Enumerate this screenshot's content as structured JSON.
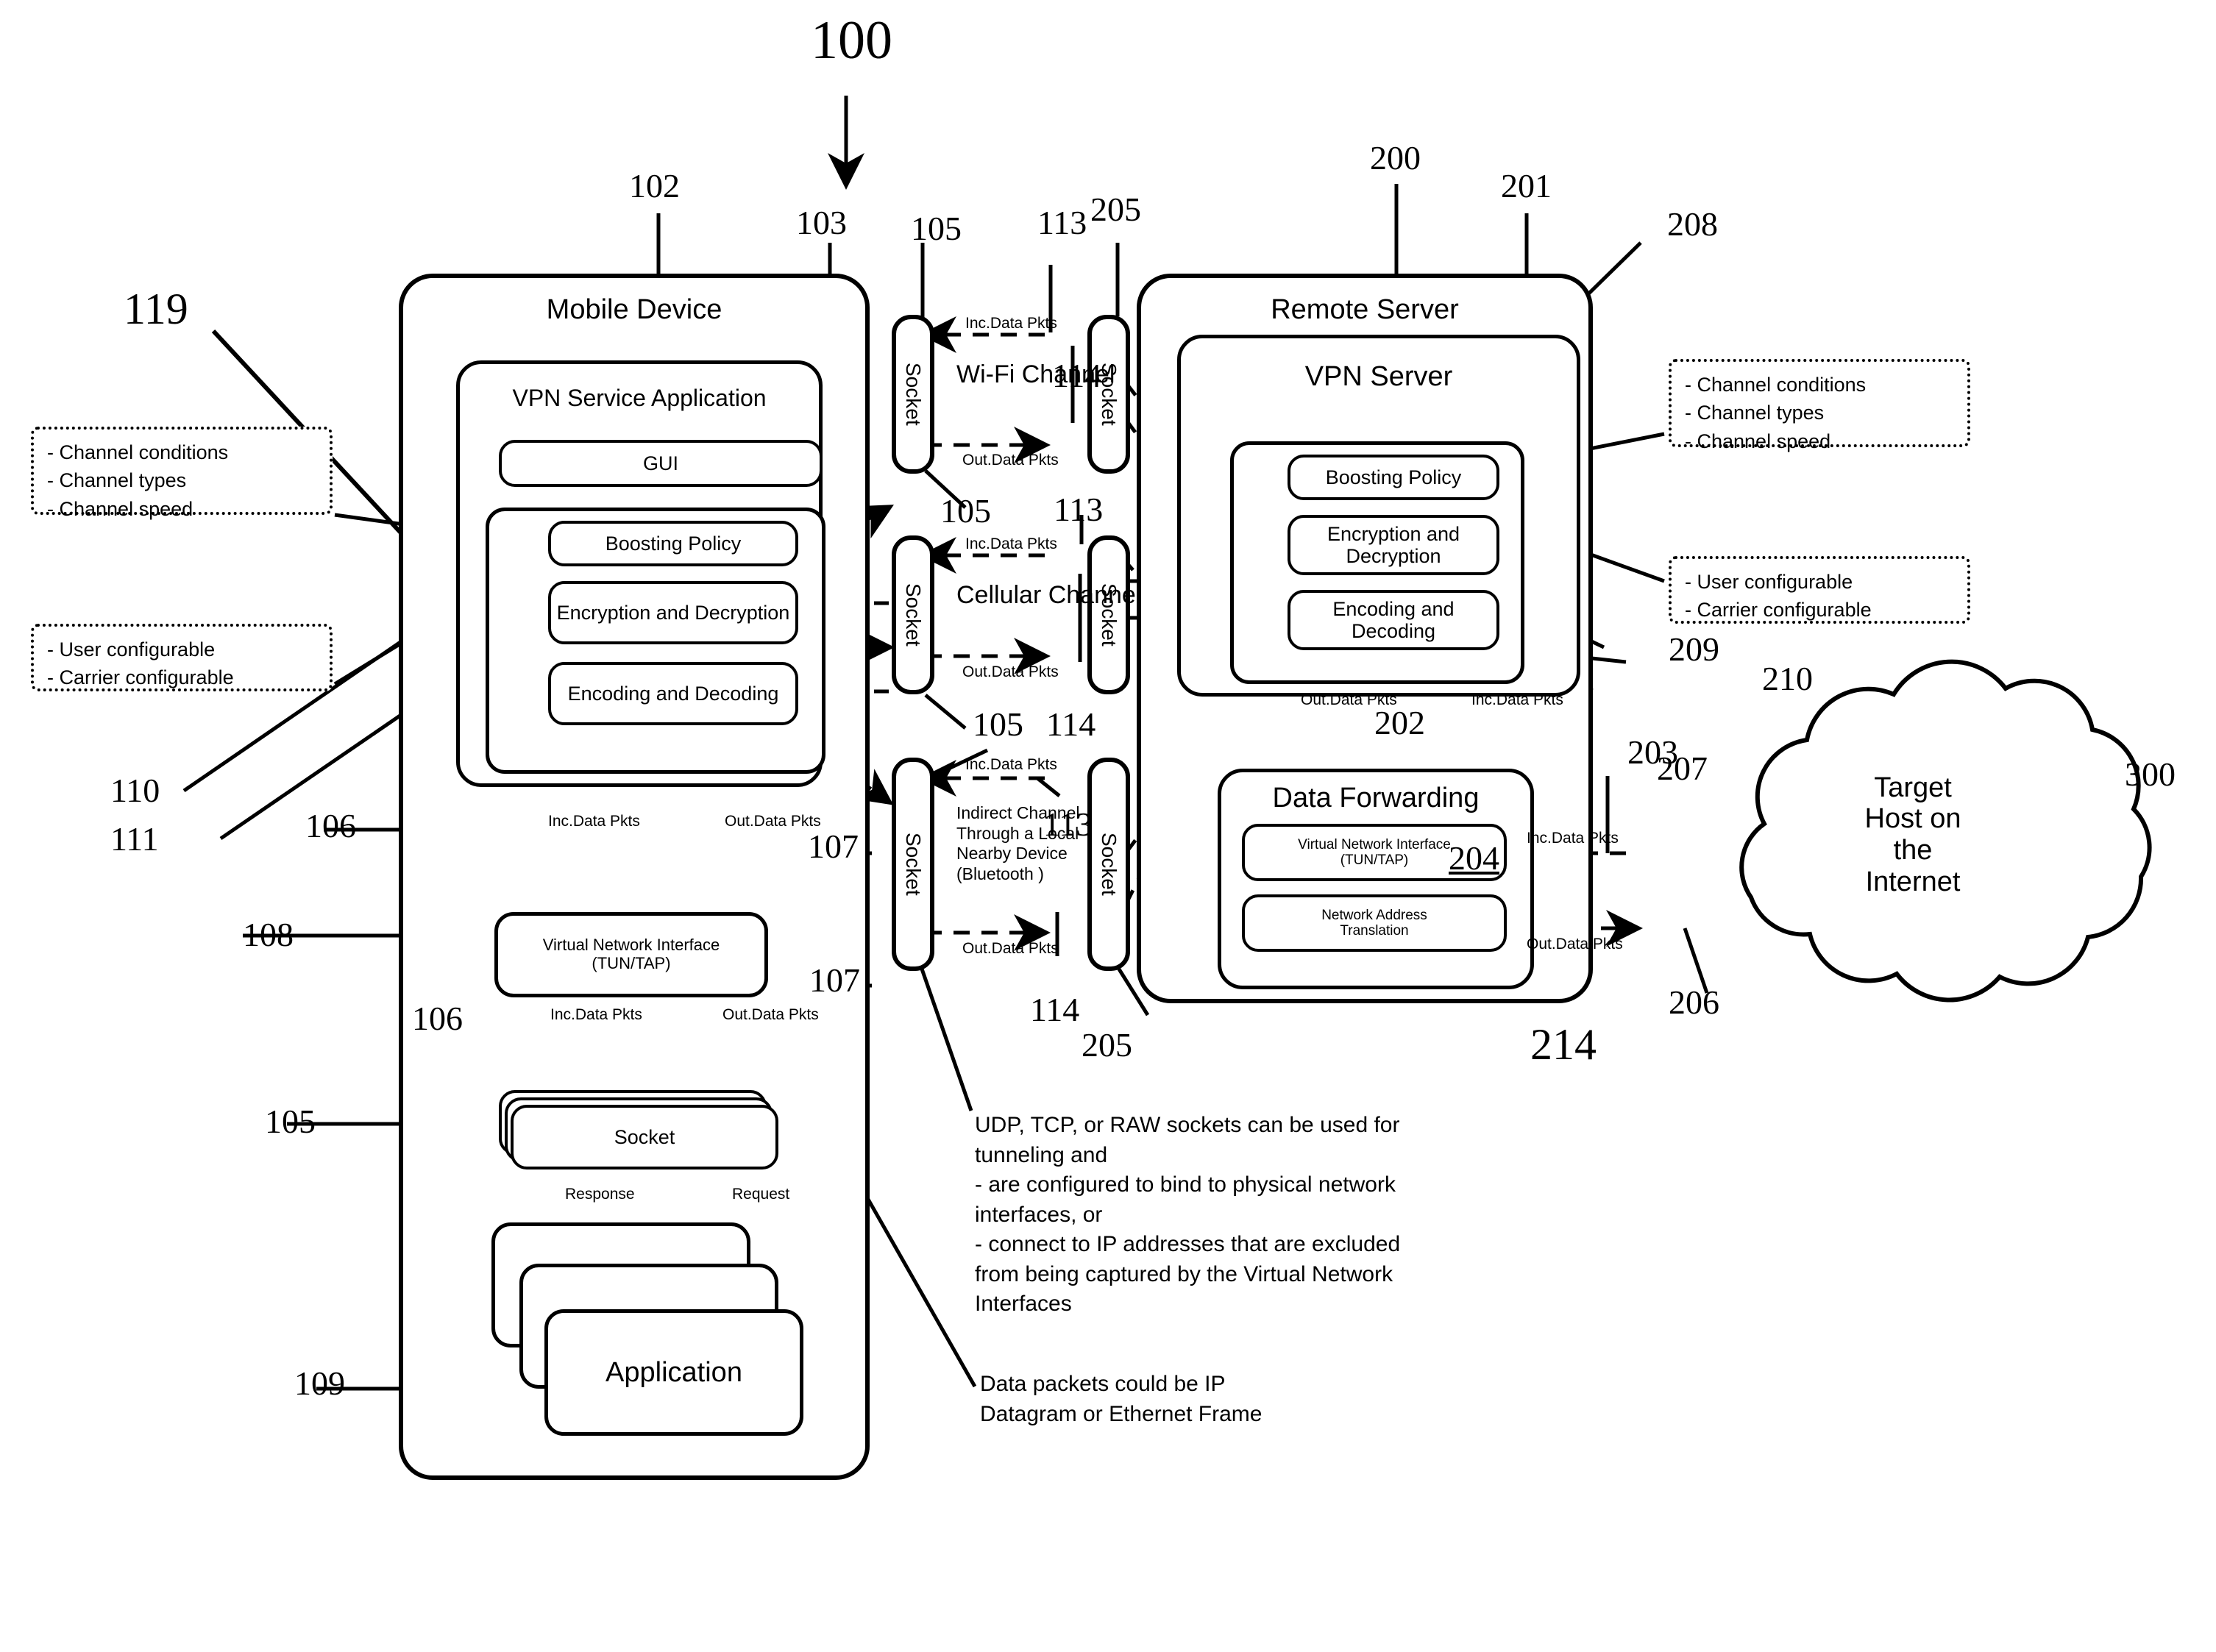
{
  "figure": {
    "number": "100"
  },
  "mobile_device": {
    "title": "Mobile Device",
    "ref": "102",
    "vpn_service_application": {
      "title": "VPN Service Application",
      "ref": "103",
      "gui": "GUI",
      "modules": [
        {
          "label": "Boosting Policy",
          "ref": "110"
        },
        {
          "label": "Encryption and Decryption",
          "ref": "111"
        },
        {
          "label": "Encoding and Decoding",
          "ref": "119"
        }
      ]
    },
    "virtual_network_interface": {
      "label": "Virtual Network Interface (TUN/TAP)",
      "line1": "Virtual Network Interface",
      "line2": "(TUN/TAP)",
      "ref": "108"
    },
    "socket": {
      "label": "Socket",
      "ref": "105"
    },
    "application": {
      "label": "Application",
      "ref": "109"
    },
    "flow_labels": {
      "inc": "Inc.Data Pkts",
      "out": "Out.Data Pkts",
      "response": "Response",
      "request": "Request",
      "inc_ref": "106",
      "out_ref": "107"
    }
  },
  "channels": [
    {
      "name": "Wi-Fi Channel",
      "inc": "Inc.Data Pkts",
      "out": "Out.Data Pkts",
      "inc_ref": "113",
      "out_ref": "114"
    },
    {
      "name": "Cellular Channel",
      "inc": "Inc.Data Pkts",
      "out": "Out.Data Pkts",
      "inc_ref": "113",
      "out_ref": "114"
    },
    {
      "name": "Indirect Channel Through a Local Nearby Device (Bluetooth  )",
      "inc": "Inc.Data Pkts",
      "out": "Out.Data Pkts",
      "inc_ref": "113",
      "out_ref": "114"
    }
  ],
  "sockets": {
    "label": "Socket",
    "client_ref": "105",
    "server_ref": "205"
  },
  "remote_server": {
    "title": "Remote Server",
    "ref": "200",
    "vpn_server": {
      "title": "VPN Server",
      "ref": "201",
      "modules": [
        {
          "label": "Boosting Policy",
          "ref": "208"
        },
        {
          "label": "Encryption and Decryption",
          "ref": "209"
        },
        {
          "label": "Encoding and Decoding",
          "ref": "210"
        }
      ]
    },
    "data_forwarding": {
      "title": "Data Forwarding",
      "ref": "214",
      "virtual_network_interface": {
        "line1": "Virtual Network Interface",
        "line2": "(TUN/TAP)",
        "ref": "204"
      },
      "network_address_translation": {
        "line1": "Network Address",
        "line2": "Translation"
      }
    },
    "flow_labels": {
      "out": "Out.Data Pkts",
      "inc": "Inc.Data Pkts",
      "out_ref": "202",
      "inc_ref": "203",
      "host_inc_ref": "207",
      "host_out_ref": "206"
    }
  },
  "target_host": {
    "line1": "Target",
    "line2": "Host on",
    "line3": "the",
    "line4": "Internet",
    "ref": "300"
  },
  "callouts": {
    "left_top": {
      "lines": [
        "- Channel conditions",
        "- Channel types",
        "- Channel speed"
      ]
    },
    "left_bottom": {
      "lines": [
        "- User configurable",
        "- Carrier configurable"
      ]
    },
    "right_top": {
      "lines": [
        "- Channel conditions",
        "- Channel types",
        "- Channel speed"
      ]
    },
    "right_bottom": {
      "lines": [
        "- User configurable",
        "- Carrier configurable"
      ]
    }
  },
  "notes": {
    "sockets_note": "UDP, TCP, or RAW sockets can be used for tunneling and\n- are configured to bind to physical network interfaces, or\n- connect to IP addresses that are excluded from being captured by the Virtual Network Interfaces",
    "sockets_note_lines": [
      "UDP, TCP, or RAW sockets can be used for",
      "tunneling and",
      "- are configured to bind to physical network",
      "interfaces, or",
      "- connect to IP addresses that are excluded",
      "from being captured by the Virtual Network",
      "Interfaces"
    ],
    "packets_note_lines": [
      "Data packets could be IP",
      " Datagram or Ethernet Frame"
    ]
  },
  "colors": {
    "ink": "#000000",
    "paper": "#ffffff"
  }
}
